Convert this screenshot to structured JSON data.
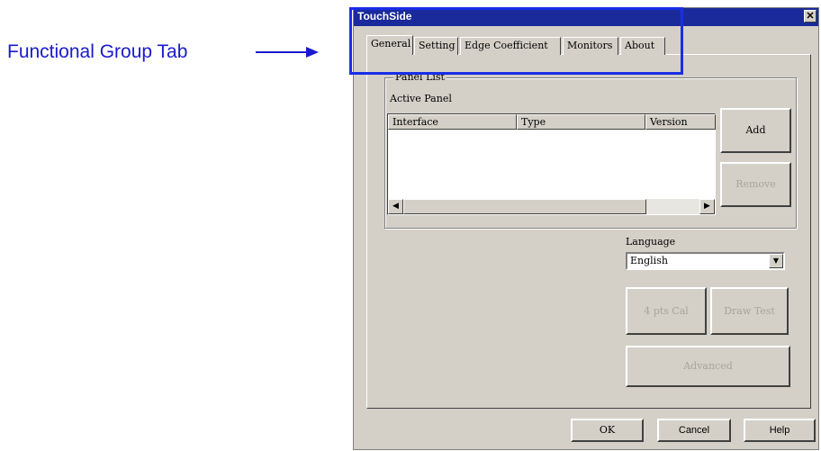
{
  "annotation": {
    "callout_text": "Functional Group Tab",
    "color": "#1a1acc",
    "highlight_color": "#1a2ee6"
  },
  "window": {
    "title": "TouchSide",
    "close_icon": "close-icon",
    "titlebar_color": "#1a2a9a"
  },
  "tabs": [
    {
      "label": "General",
      "active": true
    },
    {
      "label": "Setting",
      "active": false
    },
    {
      "label": "Edge Coefficient",
      "active": false
    },
    {
      "label": "Monitors",
      "active": false
    },
    {
      "label": "About",
      "active": false
    }
  ],
  "panel_list": {
    "group_title": "Panel List",
    "active_panel_label": "Active Panel",
    "columns": [
      "Interface",
      "Type",
      "Version"
    ],
    "rows": [],
    "scroll_left_icon": "arrow-left-icon",
    "scroll_right_icon": "arrow-right-icon"
  },
  "buttons": {
    "add": "Add",
    "remove": "Remove",
    "cal": "4 pts Cal",
    "draw_test": "Draw Test",
    "advanced": "Advanced",
    "ok": "OK",
    "cancel": "Cancel",
    "help": "Help"
  },
  "language": {
    "label": "Language",
    "selected": "English",
    "dropdown_icon": "chevron-down-icon"
  }
}
